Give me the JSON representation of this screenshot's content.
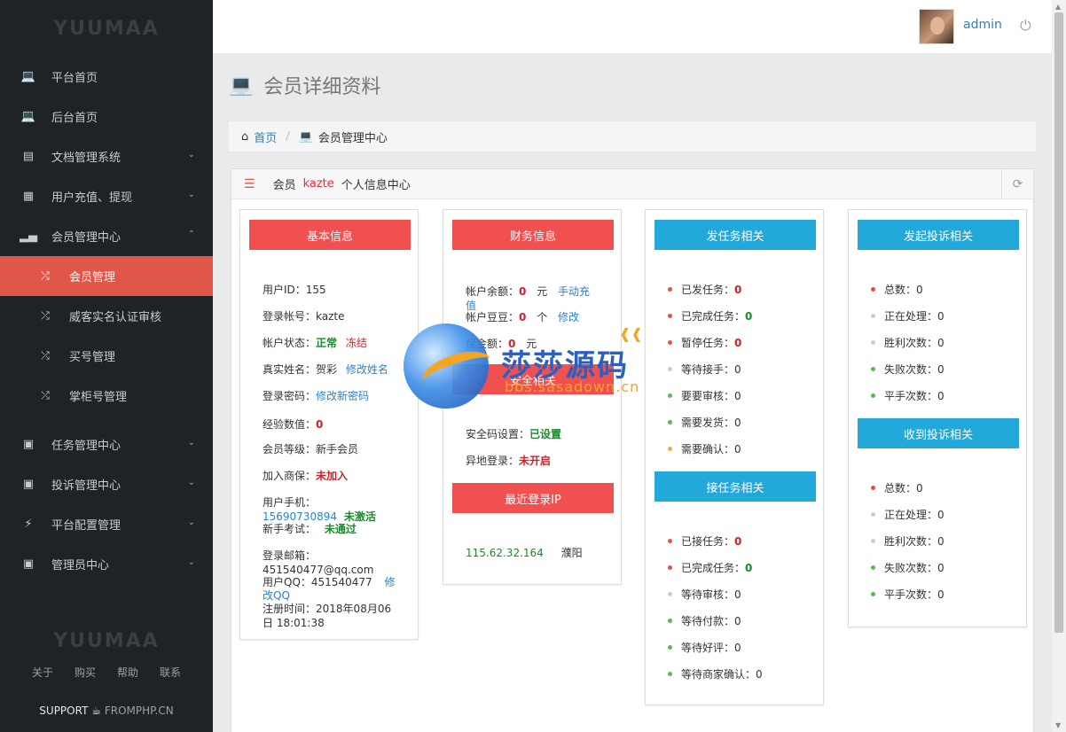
{
  "sidebar": {
    "logo": "YUUMAA",
    "items": [
      {
        "label": "平台首页",
        "icon": "laptop-icon"
      },
      {
        "label": "后台首页",
        "icon": "laptop-icon"
      },
      {
        "label": "文档管理系统",
        "icon": "file-icon"
      },
      {
        "label": "用户充值、提现",
        "icon": "card-icon"
      },
      {
        "label": "会员管理中心",
        "icon": "bar-chart-icon"
      }
    ],
    "sub_items": [
      {
        "label": "会员管理",
        "icon": "shuffle-icon"
      },
      {
        "label": "威客实名认证审核",
        "icon": "shuffle-icon"
      },
      {
        "label": "买号管理",
        "icon": "shuffle-icon"
      },
      {
        "label": "掌柜号管理",
        "icon": "shuffle-icon"
      }
    ],
    "items2": [
      {
        "label": "任务管理中心",
        "icon": "briefcase-icon"
      },
      {
        "label": "投诉管理中心",
        "icon": "briefcase-icon"
      },
      {
        "label": "平台配置管理",
        "icon": "bolt-icon"
      },
      {
        "label": "管理员中心",
        "icon": "briefcase-icon"
      }
    ],
    "footer": {
      "logo": "YUUMAA",
      "links": [
        "关于",
        "购买",
        "帮助",
        "联系"
      ],
      "support": "SUPPORT",
      "support_site": "FROMPHP.CN"
    }
  },
  "topbar": {
    "user": "admin"
  },
  "page": {
    "title": "会员详细资料",
    "breadcrumb": {
      "home": "首页",
      "current": "会员管理中心"
    }
  },
  "panel": {
    "prefix": "会员",
    "username": "kazte",
    "suffix": "个人信息中心"
  },
  "basic": {
    "title": "基本信息",
    "user_id_label": "用户ID：",
    "user_id": "155",
    "account_label": "登录帐号：",
    "account": "kazte",
    "status_label": "帐户状态：",
    "status_normal": "正常",
    "status_freeze": "冻结",
    "realname_label": "真实姓名：",
    "realname": "贺彩",
    "realname_edit": "修改姓名",
    "password_label": "登录密码：",
    "password_edit": "修改新密码",
    "exp_label": "经验数值：",
    "exp": "0",
    "level_label": "会员等级：",
    "level": "新手会员",
    "join_label": "加入商保：",
    "join": "未加入",
    "phone_label": "用户手机：",
    "phone": "15690730894",
    "phone_status": "未激活",
    "exam_label": "新手考试：",
    "exam": "未通过",
    "email_label": "登录邮箱：",
    "email": "451540477@qq.com",
    "qq_label": "用户QQ：",
    "qq": "451540477",
    "qq_edit_1": "修",
    "qq_edit_2": "改QQ",
    "reg_label": "注册时间：",
    "reg_1": "2018年08月06",
    "reg_2": "日 18:01:38"
  },
  "finance": {
    "title": "财务信息",
    "balance_label": "帐户余额：",
    "balance": "0",
    "balance_unit": "元",
    "recharge_1": "手动充",
    "recharge_2": "值",
    "beans_label": "帐户豆豆：",
    "beans": "0",
    "beans_unit": "个",
    "beans_edit": "修改",
    "deposit_label": "保金额：",
    "deposit": "0",
    "deposit_unit": "元",
    "security_title": "安全相关",
    "security_code_label": "安全码设置：",
    "security_code": "已设置",
    "remote_login_label": "异地登录：",
    "remote_login": "未开启",
    "ip_title": "最近登录IP",
    "ip": "115.62.32.164",
    "ip_location": "濮阳"
  },
  "publish": {
    "title": "发任务相关",
    "rows": [
      {
        "label": "已发任务：",
        "value": "0",
        "dot": "red",
        "style": "red"
      },
      {
        "label": "已完成任务：",
        "value": "0",
        "dot": "red",
        "style": "green"
      },
      {
        "label": "暂停任务：",
        "value": "0",
        "dot": "red",
        "style": "red"
      },
      {
        "label": "等待接手：",
        "value": "0",
        "dot": "gray",
        "style": "plain"
      },
      {
        "label": "要要审核：",
        "value": "0",
        "dot": "green",
        "style": "plain"
      },
      {
        "label": "需要发货：",
        "value": "0",
        "dot": "green",
        "style": "plain"
      },
      {
        "label": "需要确认：",
        "value": "0",
        "dot": "orange",
        "style": "plain"
      }
    ]
  },
  "receive": {
    "title": "接任务相关",
    "rows": [
      {
        "label": "已接任务：",
        "value": "0",
        "dot": "red",
        "style": "red"
      },
      {
        "label": "已完成任务：",
        "value": "0",
        "dot": "red",
        "style": "green"
      },
      {
        "label": "等待审核：",
        "value": "0",
        "dot": "gray",
        "style": "plain"
      },
      {
        "label": "等待付款：",
        "value": "0",
        "dot": "green",
        "style": "plain"
      },
      {
        "label": "等待好评：",
        "value": "0",
        "dot": "green",
        "style": "plain"
      },
      {
        "label": "等待商家确认：",
        "value": "0",
        "dot": "green",
        "style": "plain"
      }
    ]
  },
  "complaint_out": {
    "title": "发起投诉相关",
    "rows": [
      {
        "label": "总数：",
        "value": "0",
        "dot": "red"
      },
      {
        "label": "正在处理：",
        "value": "0",
        "dot": "gray"
      },
      {
        "label": "胜利次数：",
        "value": "0",
        "dot": "gray"
      },
      {
        "label": "失败次数：",
        "value": "0",
        "dot": "green"
      },
      {
        "label": "平手次数：",
        "value": "0",
        "dot": "green"
      }
    ]
  },
  "complaint_in": {
    "title": "收到投诉相关",
    "rows": [
      {
        "label": "总数：",
        "value": "0",
        "dot": "red"
      },
      {
        "label": "正在处理：",
        "value": "0",
        "dot": "gray"
      },
      {
        "label": "胜利次数：",
        "value": "0",
        "dot": "gray"
      },
      {
        "label": "失败次数：",
        "value": "0",
        "dot": "green"
      },
      {
        "label": "平手次数：",
        "value": "0",
        "dot": "green"
      }
    ]
  },
  "watermark": {
    "cn": "莎莎源码",
    "en": "bbs.sasadown.cn"
  }
}
